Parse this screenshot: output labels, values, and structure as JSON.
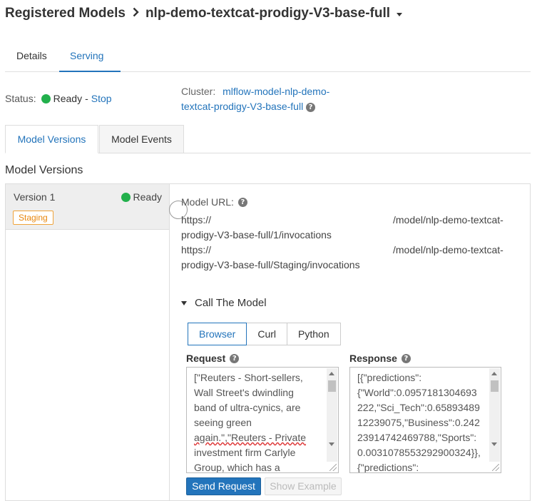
{
  "breadcrumb": {
    "root": "Registered Models",
    "model_name": "nlp-demo-textcat-prodigy-V3-base-full"
  },
  "top_tabs": [
    {
      "label": "Details",
      "active": false
    },
    {
      "label": "Serving",
      "active": true
    }
  ],
  "status": {
    "label": "Status:",
    "value": "Ready",
    "separator": "-",
    "stop_link": "Stop",
    "color": "#22b04c"
  },
  "cluster": {
    "label": "Cluster:",
    "link_line1": "mlflow-model-nlp-demo-",
    "link_line2": "textcat-prodigy-V3-base-full"
  },
  "model_tabs": [
    {
      "label": "Model Versions",
      "active": true
    },
    {
      "label": "Model Events",
      "active": false
    }
  ],
  "section_title": "Model Versions",
  "versions": [
    {
      "name": "Version 1",
      "status": "Ready",
      "stage": "Staging"
    }
  ],
  "model_url": {
    "label": "Model URL:",
    "urls": [
      {
        "prefix": "https://",
        "suffix": "/model/nlp-demo-textcat-",
        "line2": "prodigy-V3-base-full/1/invocations"
      },
      {
        "prefix": "https://",
        "suffix": "/model/nlp-demo-textcat-",
        "line2": "prodigy-V3-base-full/Staging/invocations"
      }
    ]
  },
  "call_model": {
    "title": "Call The Model",
    "modes": [
      {
        "label": "Browser",
        "active": true
      },
      {
        "label": "Curl",
        "active": false
      },
      {
        "label": "Python",
        "active": false
      }
    ],
    "request_label": "Request",
    "response_label": "Response",
    "request_lines": [
      "[\"Reuters - Short-sellers,",
      "Wall Street's dwindling",
      "band of ultra-cynics, are",
      "seeing green",
      "again.\",\"Reuters - Private",
      "investment firm Carlyle",
      "Group, which has a"
    ],
    "response_lines": [
      "[{\"predictions\":",
      "{\"World\":0.0957181304693",
      "222,\"Sci_Tech\":0.65893489",
      "12239075,\"Business\":0.242",
      "23914742469788,\"Sports\":",
      "0.0031078553292900324}},",
      "{\"predictions\":"
    ],
    "send_button": "Send Request",
    "example_button": "Show Example"
  },
  "colors": {
    "accent": "#2374bb",
    "ready": "#22b04c",
    "staging": "#e8860c"
  }
}
